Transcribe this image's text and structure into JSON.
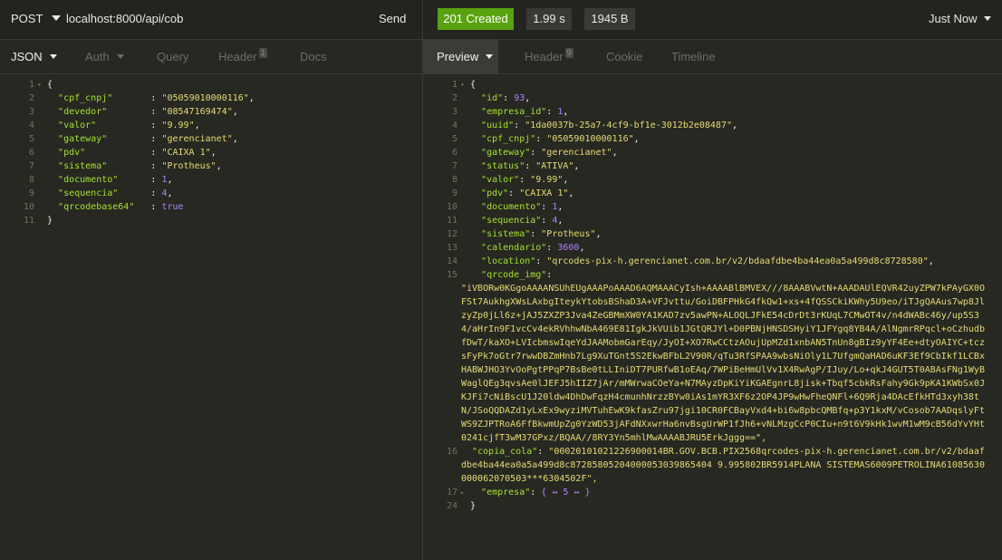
{
  "request": {
    "method": "POST",
    "url": "localhost:8000/api/cob",
    "send_label": "Send",
    "tabs": [
      {
        "label": "JSON"
      },
      {
        "label": "Auth"
      },
      {
        "label": "Query"
      },
      {
        "label": "Header",
        "badge": "1"
      },
      {
        "label": "Docs"
      }
    ],
    "body_lines": [
      {
        "ln": "1",
        "text": "{"
      },
      {
        "ln": "2",
        "key": "\"cpf_cnpj\"",
        "pad": "       ",
        "val": "\"05059010000116\"",
        "type": "s"
      },
      {
        "ln": "3",
        "key": "\"devedor\"",
        "pad": "        ",
        "val": "\"08547169474\"",
        "type": "s"
      },
      {
        "ln": "4",
        "key": "\"valor\"",
        "pad": "          ",
        "val": "\"9.99\"",
        "type": "s"
      },
      {
        "ln": "5",
        "key": "\"gateway\"",
        "pad": "        ",
        "val": "\"gerencianet\"",
        "type": "s"
      },
      {
        "ln": "6",
        "key": "\"pdv\"",
        "pad": "            ",
        "val": "\"CAIXA 1\"",
        "type": "s"
      },
      {
        "ln": "7",
        "key": "\"sistema\"",
        "pad": "        ",
        "val": "\"Protheus\"",
        "type": "s"
      },
      {
        "ln": "8",
        "key": "\"documento\"",
        "pad": "      ",
        "val": "1",
        "type": "n"
      },
      {
        "ln": "9",
        "key": "\"sequencia\"",
        "pad": "      ",
        "val": "4",
        "type": "n"
      },
      {
        "ln": "10",
        "key": "\"qrcodebase64\"",
        "pad": "   ",
        "val": "true",
        "type": "n",
        "last": true
      },
      {
        "ln": "11",
        "text": "}"
      }
    ]
  },
  "response": {
    "status": "201 Created",
    "time": "1.99 s",
    "size": "1945 B",
    "history": "Just Now",
    "tabs": [
      {
        "label": "Preview"
      },
      {
        "label": "Header",
        "badge": "9"
      },
      {
        "label": "Cookie"
      },
      {
        "label": "Timeline"
      }
    ],
    "lines": [
      {
        "ln": "1",
        "text": "{"
      },
      {
        "ln": "2",
        "key": "\"id\"",
        "val": "93",
        "type": "n"
      },
      {
        "ln": "3",
        "key": "\"empresa_id\"",
        "val": "1",
        "type": "n"
      },
      {
        "ln": "4",
        "key": "\"uuid\"",
        "val": "\"1da0037b-25a7-4cf9-bf1e-3012b2e08487\"",
        "type": "s"
      },
      {
        "ln": "5",
        "key": "\"cpf_cnpj\"",
        "val": "\"05059010000116\"",
        "type": "s"
      },
      {
        "ln": "6",
        "key": "\"gateway\"",
        "val": "\"gerencianet\"",
        "type": "s"
      },
      {
        "ln": "7",
        "key": "\"status\"",
        "val": "\"ATIVA\"",
        "type": "s"
      },
      {
        "ln": "8",
        "key": "\"valor\"",
        "val": "\"9.99\"",
        "type": "s"
      },
      {
        "ln": "9",
        "key": "\"pdv\"",
        "val": "\"CAIXA 1\"",
        "type": "s"
      },
      {
        "ln": "10",
        "key": "\"documento\"",
        "val": "1",
        "type": "n"
      },
      {
        "ln": "11",
        "key": "\"sequencia\"",
        "val": "4",
        "type": "n"
      },
      {
        "ln": "12",
        "key": "\"sistema\"",
        "val": "\"Protheus\"",
        "type": "s"
      },
      {
        "ln": "13",
        "key": "\"calendario\"",
        "val": "3600",
        "type": "n"
      },
      {
        "ln": "14",
        "key": "\"location\"",
        "val": "\"qrcodes-pix-h.gerencianet.com.br/v2/bdaafdbe4ba44ea0a5a499d8c8728580\"",
        "type": "s"
      },
      {
        "ln": "15",
        "key": "\"qrcode_img\"",
        "val": "",
        "type": "none"
      }
    ],
    "qrcode_img_value": "\"iVBORw0KGgoAAAANSUhEUgAAAPoAAAD6AQMAAACyIsh+AAAABlBMVEX///8AAABVwtN+AAADAUlEQVR42uyZPW7kPAyGX0OFSt7AukhgXWsLAxbgIteykYtobsBShaD3A+VFJvttu/GoiDBFPHkG4fkQw1+xs+4fQSSCkiKWhy5U9eo/iTJgQAAus7wp8JlzyZp0jLl6z+jAJ5ZXZP3Jva4ZeGBMmXW0YA1KAD7zv5awPN+ALOQLJFkE54cDrDt3rKUqL7CMwOT4v/n4dWABc46y/up5S34/aHrIn9F1vcCv4ekRVhhwNbA469E81IgkJkVUib1JGtQRJYl+D0PBNjHNSDSHyiY1JFYgq8YB4A/AlNgmrRPqcl+oCzhudbfDwT/kaXO+LVIcbmswIqeYdJAAMobmGarEqy/JyOI+XO7RwCCtzAOujUpMZd1xnbAN5TnUn8gBIz9yYF4Ee+dtyOAIYC+tczsFyPk7oGtr7rwwDBZmHnb7Lg9XuTGnt5S2EkwBFbL2V90R/qTu3RfSPAA9wbsNiOly1L7UfgmQaHAD6uKF3Ef9CbIkf1LCBxHABWJHO3YvOoPgtPPqP7BsBe0tLLIniDT7PURfwB1oEAq/7WPiBeHmUlVv1X4RwAgP/IJuy/Lo+qkJ4GUT5T0ABAsFNg1WyBWaglQEg3qvsAe0lJEFJ5hIIZ7jAr/mMWrwaCOeYa+N7MAyzDpKiYiKGAEgnrL8jisk+Tbqf5cbkRsFahy9Gk9pKA1KWbSx0JKJFi7cNiBscU1J20ldw4DhDwFqzH4cmunhNrzzBYw0iAs1mYR3XF6z2OP4JP9wHwFheQNFl+6Q9Rja4DAcEfkHTd3xyh38tN/JSoQQDAZd1yLxEx9wyziMVTuhEwK9kfasZru97jgi10CR0FCBayVxd4+bi6w8pbcQMBfq+p3Y1kxM/vCosob7AADqslyFtWS9ZJPTRoA6FfBkwmUpZg0YzWD53jAFdNXxwrHa6nvBsgUrWP1fJh6+vNLMzgCcP0CIu+n9t6V9kHk1wvM1wM9cB56dYvYHt0241cjfT3wM37GPxz/BQAA//8RY3Yn5mhlMwAAAABJRU5ErkJggg==\",",
    "lines_after": [
      {
        "ln": "16",
        "key": "\"copia_cola\"",
        "val_wrapped": "\"00020101021226900014BR.GOV.BCB.PIX2568qrcodes-pix-h.gerencianet.com.br/v2/bdaafdbe4ba44ea0a5a499d8c87285805204000053039865404 9.995802BR5914PLANA SISTEMAS6009PETROLINA61085630000062070503***6304502F\","
      },
      {
        "ln": "17",
        "key": "\"empresa\"",
        "collapsed": "{ ↔ 5 ↔ }"
      },
      {
        "ln": "24",
        "text": "}"
      }
    ]
  },
  "colors": {
    "status_green": "#59a210",
    "key": "#a6e22e",
    "string": "#e6db74",
    "number": "#ae81ff"
  }
}
